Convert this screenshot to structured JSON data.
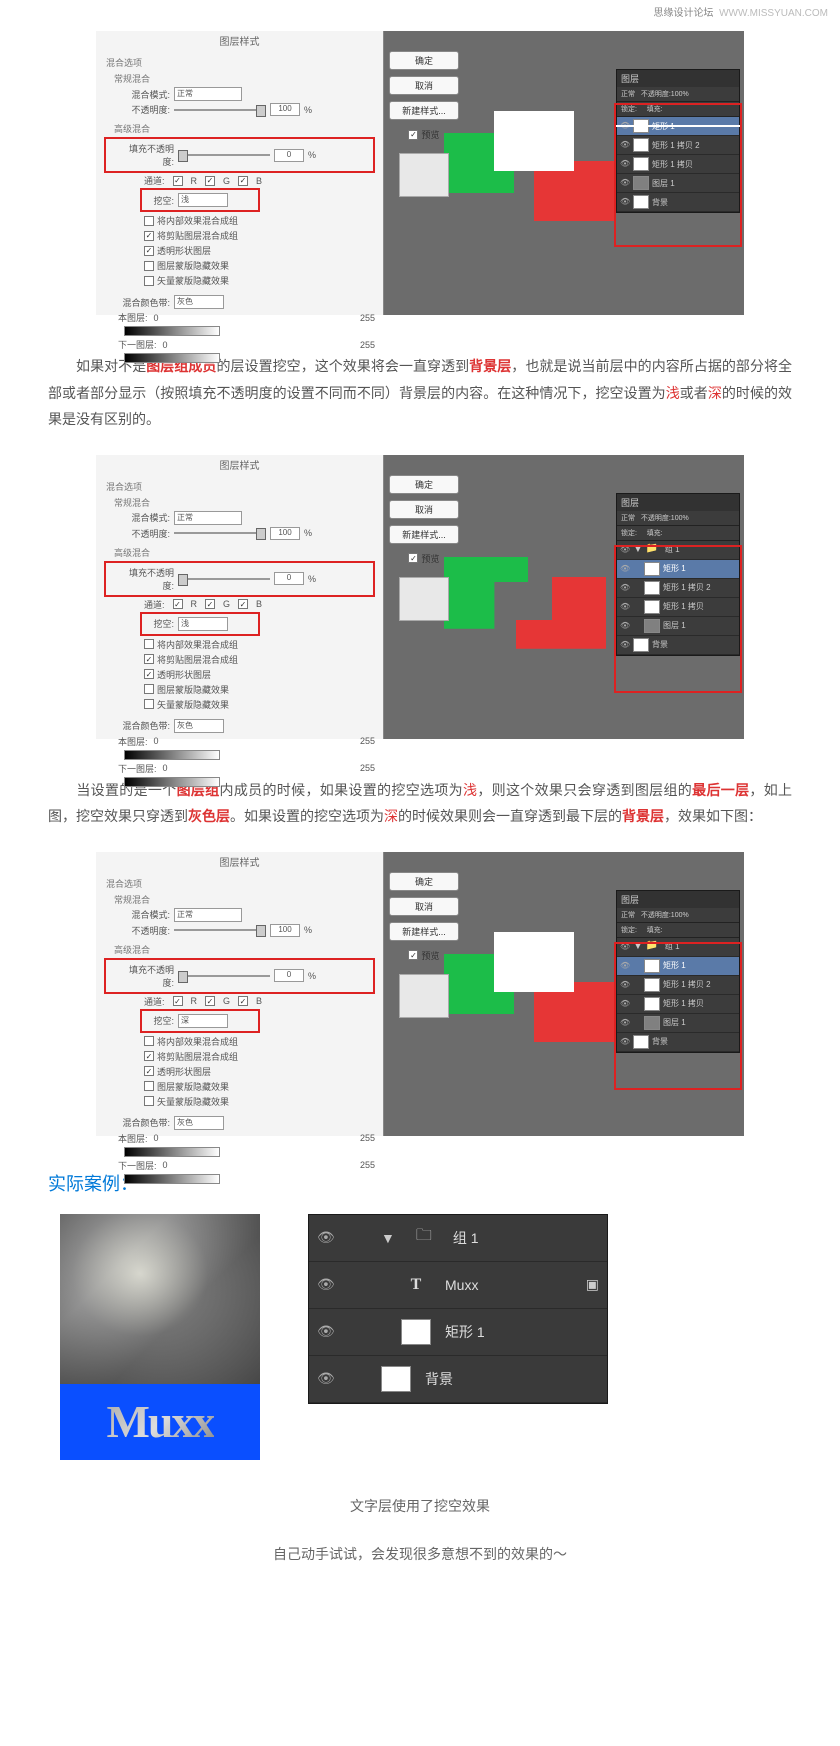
{
  "watermark": {
    "left": "思缘设计论坛",
    "right": "WWW.MISSYUAN.COM"
  },
  "dialog": {
    "title": "图层样式",
    "blend_options": "混合选项",
    "general_blend": "常规混合",
    "blend_mode_label": "混合模式:",
    "blend_mode_value": "正常",
    "opacity_label": "不透明度:",
    "opacity_value": "100",
    "percent": "%",
    "advanced_blend": "高级混合",
    "fill_opacity_label": "填充不透明度:",
    "fill_opacity_value": "0",
    "channels_label": "通道:",
    "channel_r": "R",
    "channel_g": "G",
    "channel_b": "B",
    "knockout_label": "挖空:",
    "knockout_shallow": "浅",
    "knockout_deep": "深",
    "cb1": "将内部效果混合成组",
    "cb2": "将剪贴图层混合成组",
    "cb3": "透明形状图层",
    "cb4": "图层蒙版隐藏效果",
    "cb5": "矢量蒙版隐藏效果",
    "blend_if_label": "混合颜色带:",
    "blend_if_value": "灰色",
    "this_layer": "本图层:",
    "next_layer": "下一图层:",
    "val0": "0",
    "val255": "255",
    "btn_ok": "确定",
    "btn_cancel": "取消",
    "btn_new": "新建样式...",
    "cb_preview": "预览"
  },
  "layers_panel": {
    "title": "图层",
    "mode": "正常",
    "opacity_label": "不透明度:",
    "opacity_val": "100%",
    "lock_label": "锁定:",
    "fill_label": "填充:",
    "group1": "组 1",
    "rect1": "矩形 1",
    "rect1c2": "矩形 1 拷贝 2",
    "rect1c": "矩形 1 拷贝",
    "layer1": "图层 1",
    "background": "背景"
  },
  "para1": {
    "t1": "如果对不是",
    "h1": "图层组成员",
    "t2": "的层设置挖空，这个效果将会一直穿透到",
    "h2": "背景层",
    "t3": "，也就是说当前层中的内容所占据的部分将全部或者部分显示（按照填充不透明度的设置不同而不同）背景层的内容。在这种情况下，挖空设置为",
    "h3": "浅",
    "t4": "或者",
    "h4": "深",
    "t5": "的时候的效果是没有区别的。"
  },
  "para2": {
    "t1": "当设置的是一个",
    "h1": "图层组",
    "t2": "内成员的时候，如果设置的挖空选项为",
    "h2": "浅",
    "t3": "，则这个效果只会穿透到图层组的",
    "h3": "最后一层",
    "t4": "，如上图，挖空效果只穿透到",
    "h4": "灰色层",
    "t5": "。如果设置的挖空选项为",
    "h5": "深",
    "t6": "的时候效果则会一直穿透到最下层的",
    "h6": "背景层",
    "t7": "，效果如下图："
  },
  "heading": "实际案例：",
  "case_layers": {
    "group": "组 1",
    "text_layer": "Muxx",
    "rect": "矩形 1",
    "bg": "背景"
  },
  "muxx": "Muxx",
  "caption1": "文字层使用了挖空效果",
  "caption2": "自己动手试试，会发现很多意想不到的效果的～"
}
